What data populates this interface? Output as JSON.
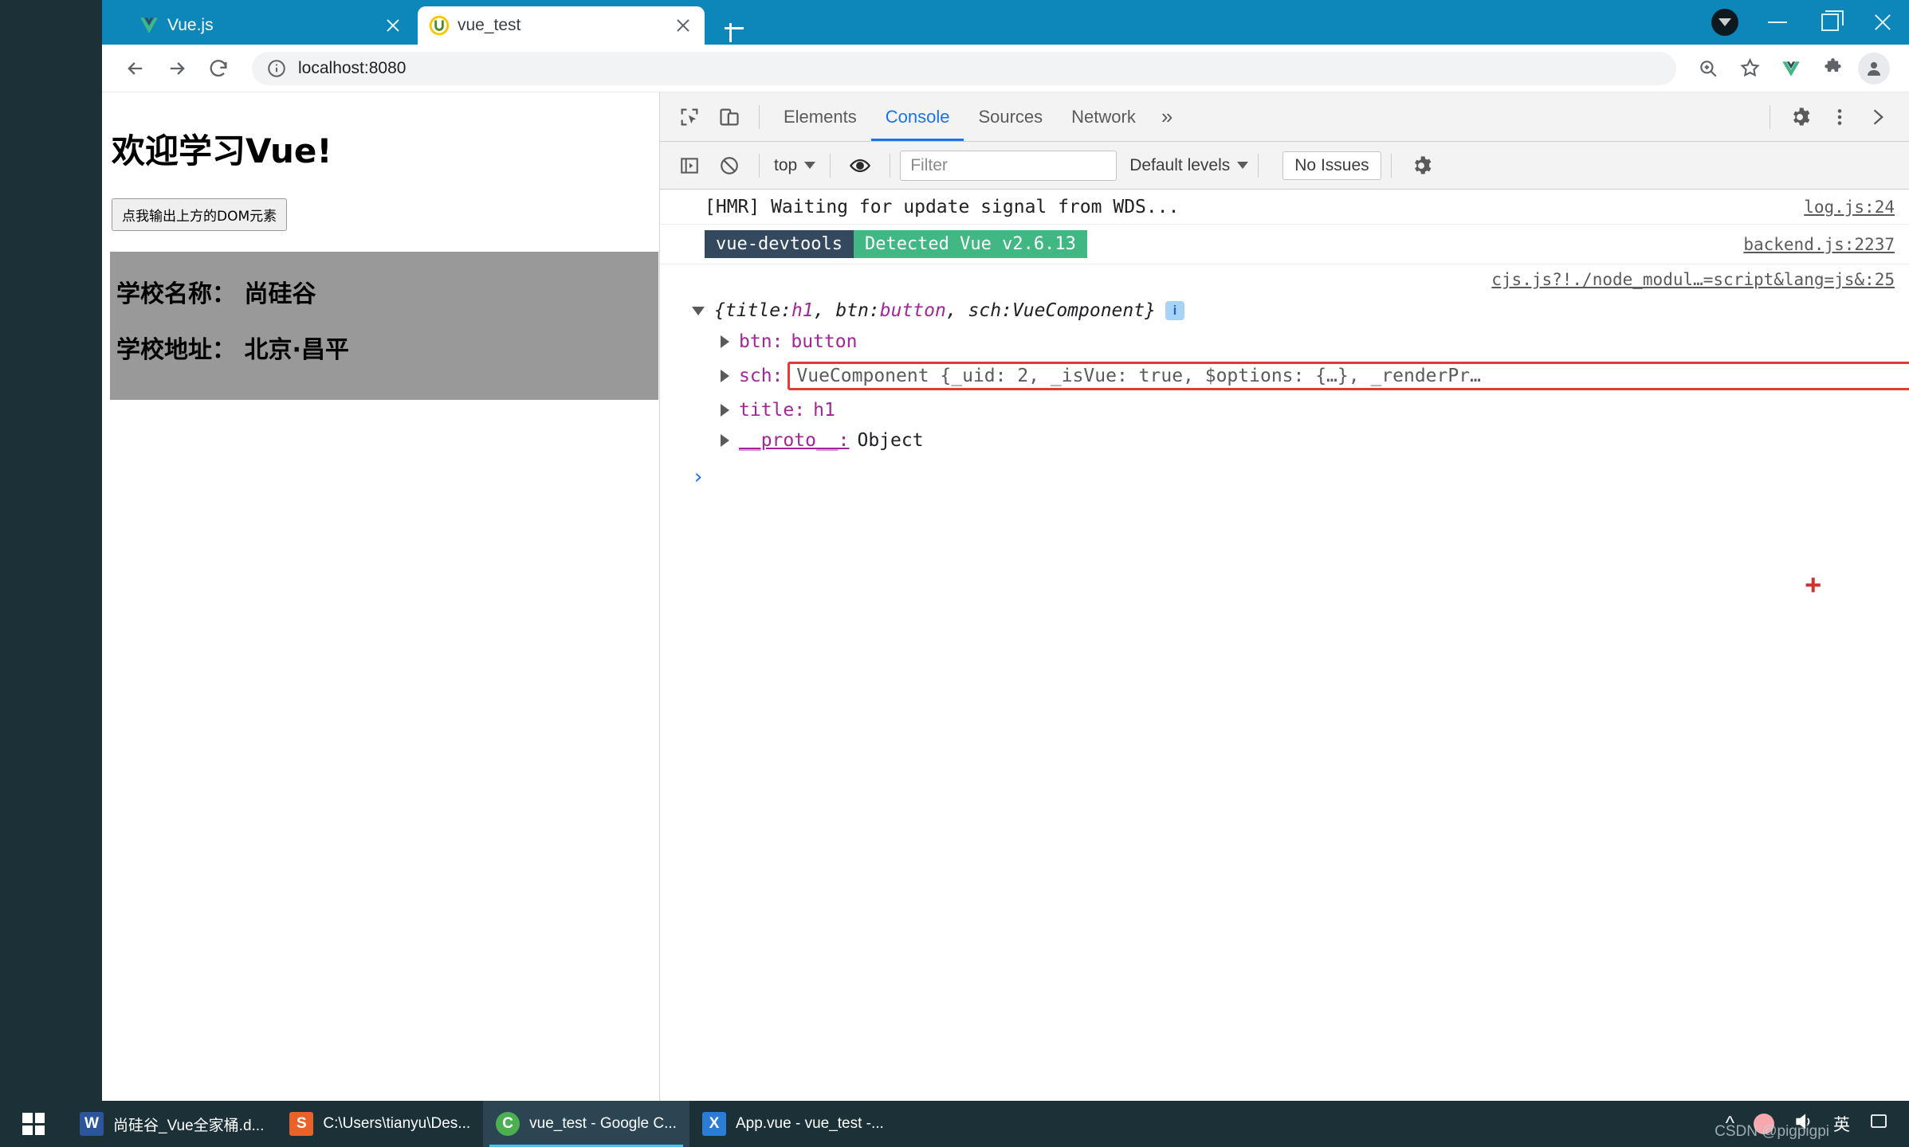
{
  "browser": {
    "tabs": [
      {
        "label": "Vue.js",
        "icon": "vue-logo-icon",
        "active": false
      },
      {
        "label": "vue_test",
        "icon": "webpack-logo-icon",
        "active": true
      }
    ],
    "new_tab_label": "+",
    "window_controls": {
      "minimize": "minimize-icon",
      "maximize": "maximize-icon",
      "close": "close-icon"
    },
    "nav": {
      "back": "back-arrow-icon",
      "forward": "forward-arrow-icon",
      "reload": "reload-icon",
      "url_scheme_icon": "info-circle-icon",
      "url": "localhost:8080",
      "url_host": "localhost",
      "url_port": ":8080",
      "zoom_icon": "zoom-search-icon",
      "bookmark_icon": "star-icon",
      "vue_ext_icon": "vue-devtools-extension-icon",
      "extensions_icon": "puzzle-piece-icon",
      "profile_icon": "person-avatar-icon"
    }
  },
  "page": {
    "heading": "欢迎学习Vue!",
    "button_label": "点我输出上方的DOM元素",
    "school": {
      "name_line": "学校名称： 尚硅谷",
      "address_line": "学校地址： 北京·昌平"
    }
  },
  "devtools": {
    "inspect_icon": "inspect-element-icon",
    "device_icon": "device-toolbar-icon",
    "tabs": [
      {
        "label": "Elements",
        "active": false
      },
      {
        "label": "Console",
        "active": true
      },
      {
        "label": "Sources",
        "active": false
      },
      {
        "label": "Network",
        "active": false
      }
    ],
    "more_tabs": "»",
    "settings_icon": "gear-icon",
    "kebab_icon": "more-vertical-icon",
    "close_icon": "close-devtools-icon",
    "filterbar": {
      "sidebar_icon": "console-sidebar-icon",
      "clear_icon": "clear-console-icon",
      "context": "top",
      "eye_icon": "live-expression-eye-icon",
      "filter_placeholder": "Filter",
      "filter_value": "",
      "levels": "Default levels",
      "issues": "No Issues",
      "settings_icon": "gear-icon"
    },
    "console": {
      "rows": [
        {
          "text": "[HMR] Waiting for update signal from WDS...",
          "source": "log.js:24"
        }
      ],
      "devtools_badge": {
        "name": "vue-devtools",
        "message": "Detected Vue v2.6.13",
        "source": "backend.js:2237",
        "dark_color": "#35495e",
        "green_color": "#41b883"
      },
      "object_source": "cjs.js?!./node_modul…=script&lang=js&:25",
      "object_summary": {
        "open_brace": "{",
        "parts": [
          {
            "key": "title: ",
            "value": "h1"
          },
          {
            "key": ", btn: ",
            "value": "button"
          },
          {
            "key": ", sch: ",
            "value": "VueComponent"
          }
        ],
        "close_brace": "}",
        "info_glyph": "i"
      },
      "properties": [
        {
          "key": "btn:",
          "value": "button",
          "highlight": false
        },
        {
          "key": "sch:",
          "value": "VueComponent {_uid: 2, _isVue: true, $options: {…}, _renderPr…",
          "highlight": true
        },
        {
          "key": "title:",
          "value": "h1",
          "highlight": false
        },
        {
          "key": "__proto__:",
          "value": "Object",
          "highlight": false
        }
      ],
      "prompt_glyph": "›",
      "annotation_plus": "+"
    }
  },
  "taskbar": {
    "start_label": "start-button",
    "items": [
      {
        "icon_letter": "W",
        "icon_color": "#2b579a",
        "label": "尚硅谷_Vue全家桶.d...",
        "active": false
      },
      {
        "icon_letter": "S",
        "icon_color": "#e8622a",
        "label": "C:\\Users\\tianyu\\Des...",
        "active": false
      },
      {
        "icon_letter": "C",
        "icon_color": "#4caf50",
        "label": "vue_test - Google C...",
        "active": true
      },
      {
        "icon_letter": "X",
        "icon_color": "#2b7cd3",
        "label": "App.vue - vue_test -...",
        "active": false
      }
    ],
    "tray": {
      "chevron_up": "^",
      "flower_icon": "flower-tray-icon",
      "volume_icon": "volume-icon",
      "ime_label": "英",
      "notification_icon": "notification-icon"
    },
    "watermark": "CSDN @pigpigpi"
  }
}
